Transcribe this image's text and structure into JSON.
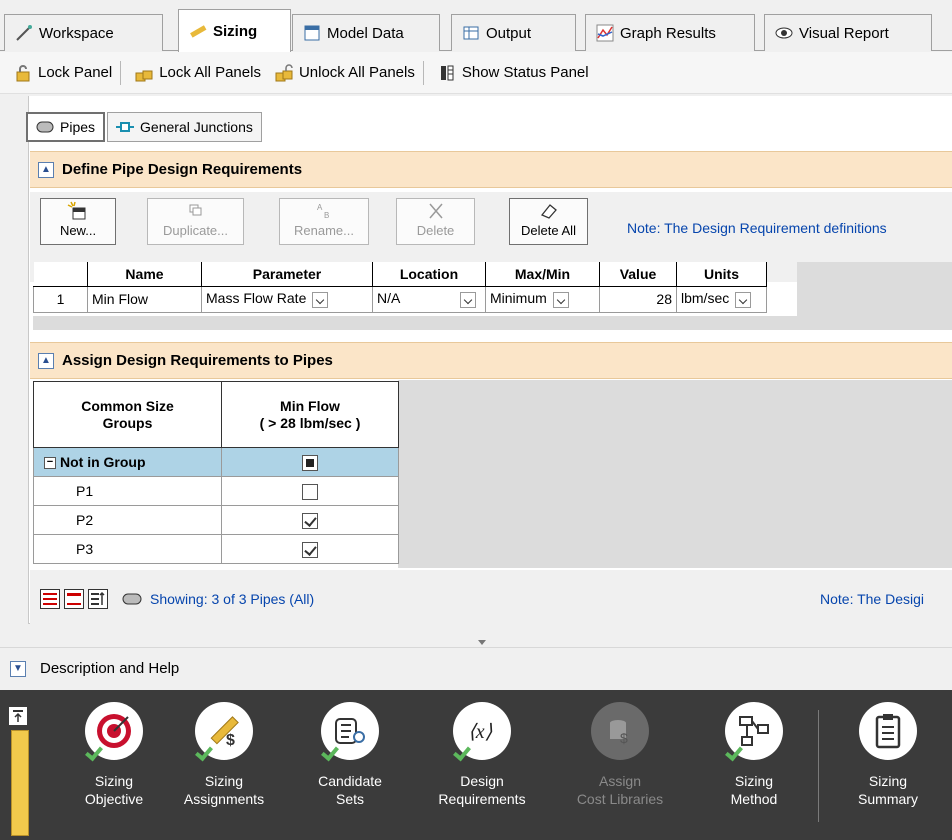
{
  "tabs": [
    {
      "label": "Workspace",
      "icon": "workspace-icon"
    },
    {
      "label": "Sizing",
      "icon": "ruler-pencil-icon",
      "active": true
    },
    {
      "label": "Model Data",
      "icon": "model-data-icon"
    },
    {
      "label": "Output",
      "icon": "table-icon"
    },
    {
      "label": "Graph Results",
      "icon": "graph-icon"
    },
    {
      "label": "Visual Report",
      "icon": "eye-icon"
    }
  ],
  "toolbar": {
    "lock_panel": "Lock Panel",
    "lock_all": "Lock All Panels",
    "unlock_all": "Unlock All Panels",
    "status_panel": "Show Status Panel"
  },
  "subtabs": {
    "pipes": "Pipes",
    "junctions": "General Junctions"
  },
  "define_section": {
    "title": "Define Pipe Design Requirements",
    "buttons": {
      "new": "New...",
      "duplicate": "Duplicate...",
      "rename": "Rename...",
      "delete": "Delete",
      "delete_all": "Delete All"
    },
    "note": "Note: The Design Requirement definitions",
    "columns": [
      "Name",
      "Parameter",
      "Location",
      "Max/Min",
      "Value",
      "Units"
    ],
    "rows": [
      {
        "num": "1",
        "name": "Min Flow",
        "parameter": "Mass Flow Rate",
        "location": "N/A",
        "maxmin": "Minimum",
        "value": "28",
        "units": "lbm/sec"
      }
    ]
  },
  "assign_section": {
    "title": "Assign Design Requirements to Pipes",
    "col1_line1": "Common Size",
    "col1_line2": "Groups",
    "col2_line1": "Min Flow",
    "col2_line2": "( > 28 lbm/sec )",
    "group_label": "Not in Group",
    "rows": [
      {
        "name": "P1",
        "checked": false
      },
      {
        "name": "P2",
        "checked": true
      },
      {
        "name": "P3",
        "checked": true
      }
    ],
    "showing": "Showing: 3 of 3 Pipes (All)",
    "note": "Note: The Desigi"
  },
  "description": {
    "label": "Description and Help"
  },
  "ribbon": [
    {
      "line1": "Sizing",
      "line2": "Objective",
      "icon": "target-icon"
    },
    {
      "line1": "Sizing",
      "line2": "Assignments",
      "icon": "ruler-dollar-icon"
    },
    {
      "line1": "Candidate",
      "line2": "Sets",
      "icon": "list-search-icon"
    },
    {
      "line1": "Design",
      "line2": "Requirements",
      "icon": "function-x-icon"
    },
    {
      "line1": "Assign",
      "line2": "Cost Libraries",
      "icon": "cost-library-icon",
      "disabled": true
    },
    {
      "line1": "Sizing",
      "line2": "Method",
      "icon": "flowchart-icon"
    },
    {
      "line1": "Sizing",
      "line2": "Summary",
      "icon": "clipboard-icon"
    }
  ],
  "colors": {
    "section_header": "#fbe5c8",
    "group_row": "#aed3e6",
    "ribbon_bg": "#3b3b3b",
    "link": "#0645ad"
  }
}
